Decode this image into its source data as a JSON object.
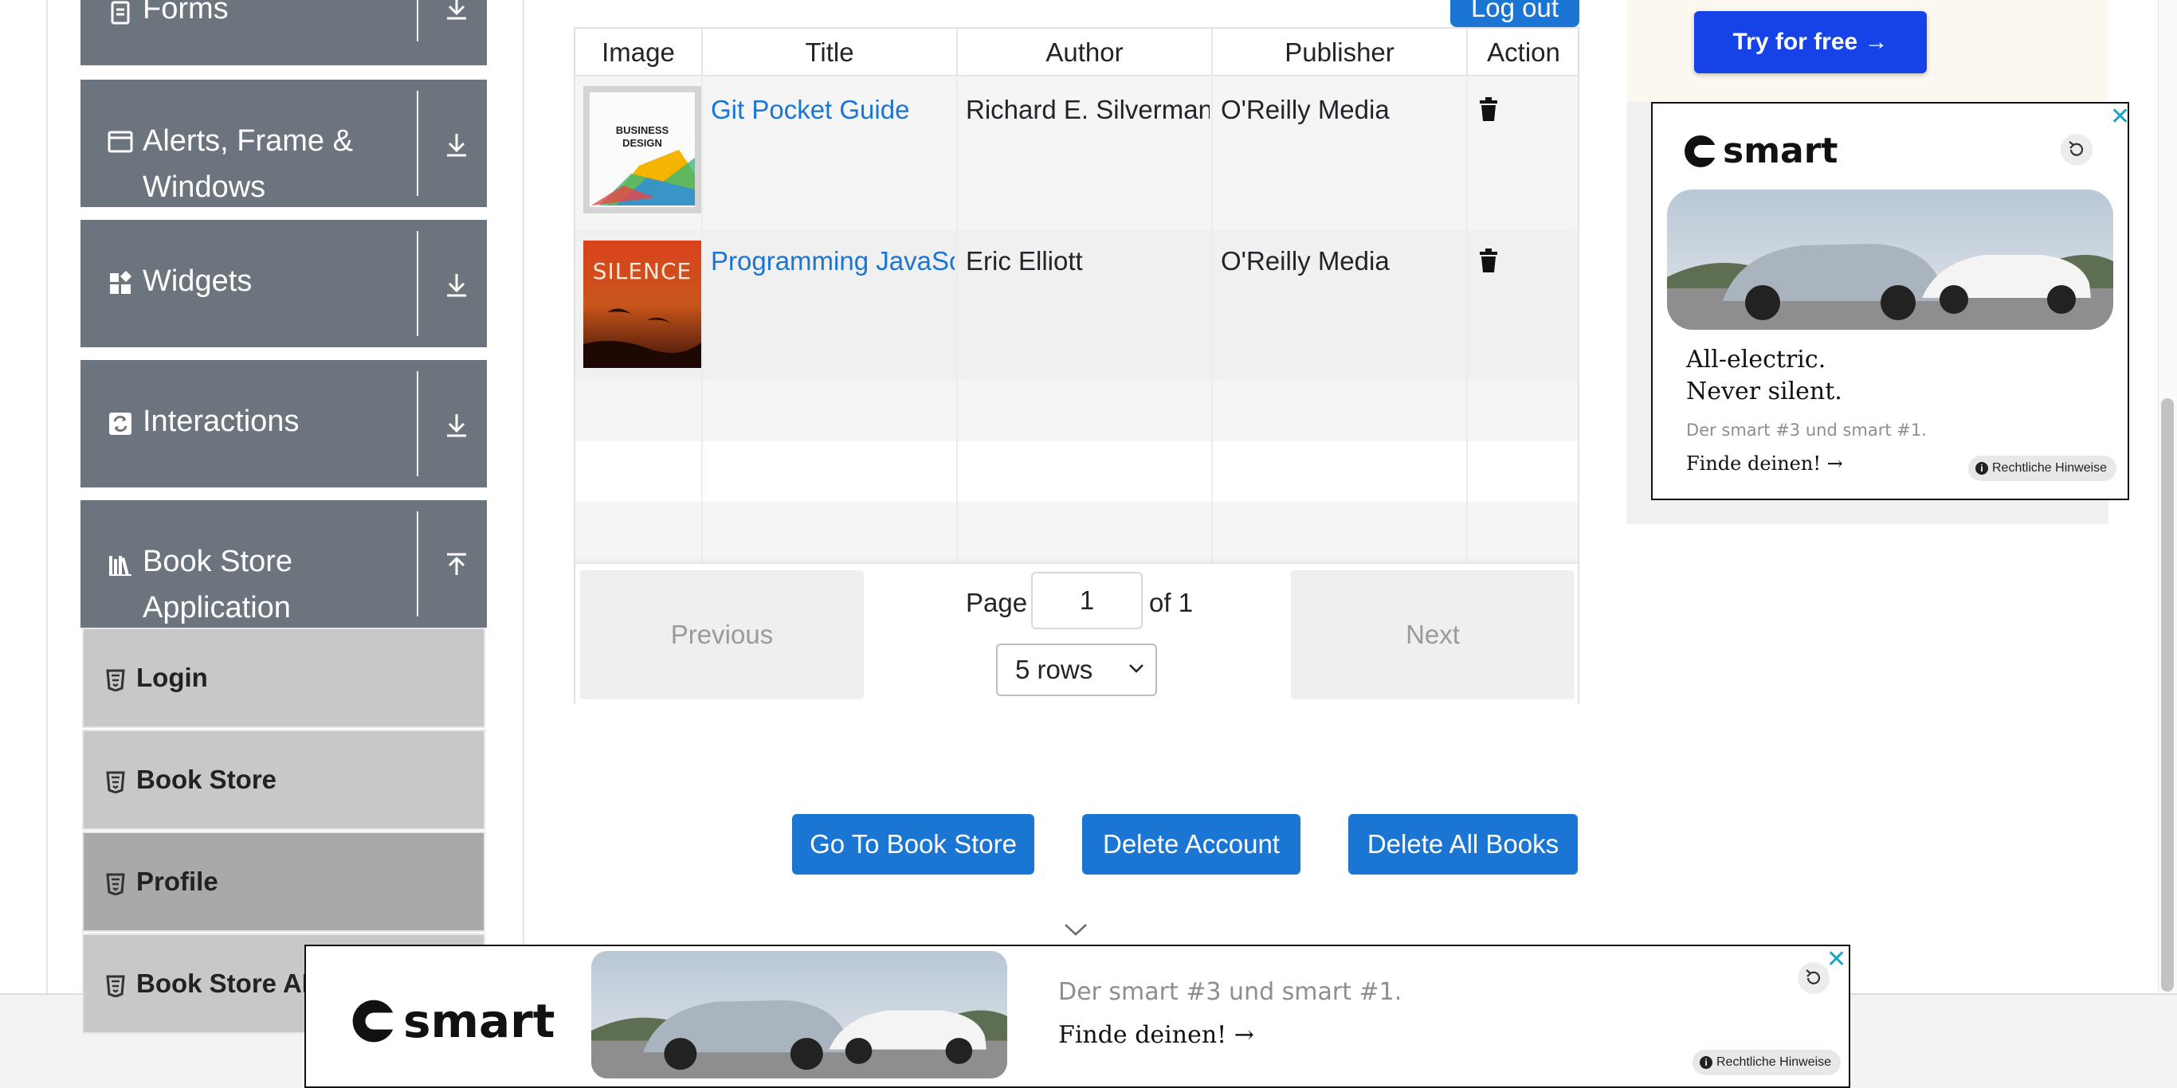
{
  "sidebar": {
    "groups": [
      {
        "label": "Forms",
        "icon": "form-icon",
        "arrow": "download-arrow-icon"
      },
      {
        "label": "Alerts, Frame &",
        "label2": "Windows",
        "icon": "window-icon",
        "arrow": "download-arrow-icon"
      },
      {
        "label": "Widgets",
        "icon": "widgets-icon",
        "arrow": "download-arrow-icon"
      },
      {
        "label": "Interactions",
        "icon": "interactions-icon",
        "arrow": "download-arrow-icon"
      },
      {
        "label": "Book Store",
        "label2": "Application",
        "icon": "books-icon",
        "arrow": "upload-arrow-icon"
      }
    ],
    "subitems": [
      {
        "label": "Login"
      },
      {
        "label": "Book Store"
      },
      {
        "label": "Profile",
        "active": true
      },
      {
        "label": "Book Store API"
      }
    ]
  },
  "header": {
    "logout_label": "Log out"
  },
  "table": {
    "columns": [
      "Image",
      "Title",
      "Author",
      "Publisher",
      "Action"
    ],
    "rows": [
      {
        "title": "Git Pocket Guide",
        "author": "Richard E. Silverman",
        "publisher": "O'Reilly Media",
        "cover_text": "BUSINESS DESIGN",
        "action_icon": "trash-icon"
      },
      {
        "title": "Programming JavaScript Applications",
        "author": "Eric Elliott",
        "publisher": "O'Reilly Media",
        "cover_text": "SILENCE",
        "action_icon": "trash-icon"
      }
    ]
  },
  "pagination": {
    "previous_label": "Previous",
    "next_label": "Next",
    "page_label": "Page",
    "page_value": "1",
    "of_label": "of 1",
    "rows_value": "5 rows"
  },
  "actions": {
    "go_to_store": "Go To Book Store",
    "delete_account": "Delete Account",
    "delete_all": "Delete All Books"
  },
  "right_ad": {
    "try_label": "Try for free →",
    "brand": "smart",
    "headline1": "All-electric.",
    "headline2": "Never silent.",
    "subline": "Der smart #3 und smart #1.",
    "cta": "Finde deinen! →",
    "legal": "Rechtliche Hinweise",
    "close": "✕"
  },
  "bottom_ad": {
    "brand": "smart",
    "subline": "Der smart #3 und smart #1.",
    "cta": "Finde deinen! →",
    "legal": "Rechtliche Hinweise",
    "close": "✕"
  },
  "colors": {
    "primary": "#1a76d2",
    "sidebar": "#6c757d",
    "ad_button": "#1543e8"
  }
}
